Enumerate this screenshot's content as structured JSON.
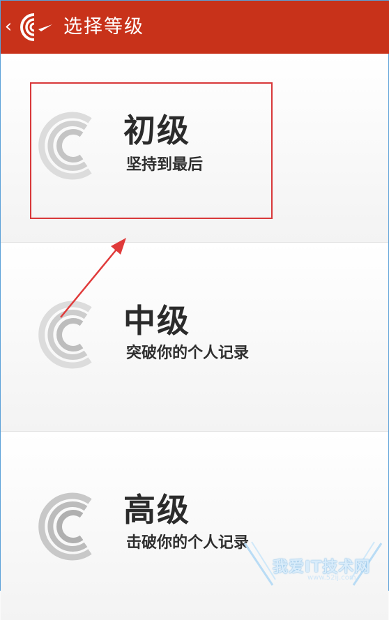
{
  "header": {
    "back_icon": "chevron-left-icon",
    "logo_icon": "app-logo-icon",
    "title": "选择等级",
    "background_color": "#c8321a"
  },
  "levels": [
    {
      "name": "初级",
      "description": "坚持到最后",
      "icon": "level-logo-icon",
      "highlighted": true
    },
    {
      "name": "中级",
      "description": "突破你的个人记录",
      "icon": "level-logo-icon",
      "highlighted": false
    },
    {
      "name": "高级",
      "description": "击破你的个人记录",
      "icon": "level-logo-icon",
      "highlighted": false
    }
  ],
  "annotation": {
    "box_color": "#d8383a",
    "arrow_icon": "annotation-arrow-icon"
  },
  "watermark": {
    "text": "我爱IT技术网",
    "url": "www.52ij.com"
  }
}
